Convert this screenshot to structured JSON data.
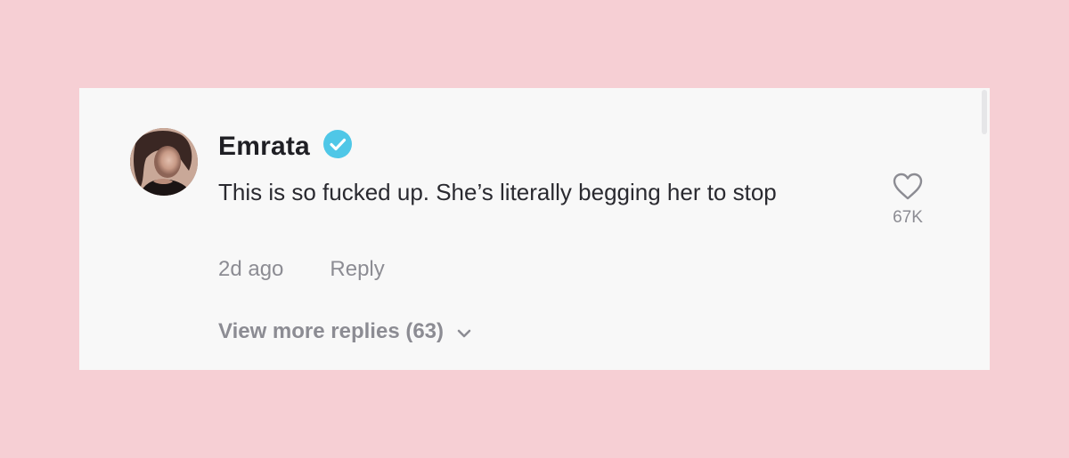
{
  "comment": {
    "username": "Emrata",
    "verified": true,
    "text": "This is so fucked up. She’s literally begging her to stop",
    "timestamp": "2d ago",
    "reply_label": "Reply",
    "like_count": "67K",
    "view_more_label": "View more replies (63)"
  },
  "colors": {
    "page_background": "#f6cfd4",
    "card_background": "#f8f8f8",
    "verified_badge": "#4fc7e7",
    "muted_text": "#8c8c93",
    "primary_text": "#1f1f24"
  },
  "icons": {
    "verified": "verified-check-icon",
    "like": "heart-icon",
    "expand": "chevron-down-icon",
    "avatar": "user-avatar"
  }
}
